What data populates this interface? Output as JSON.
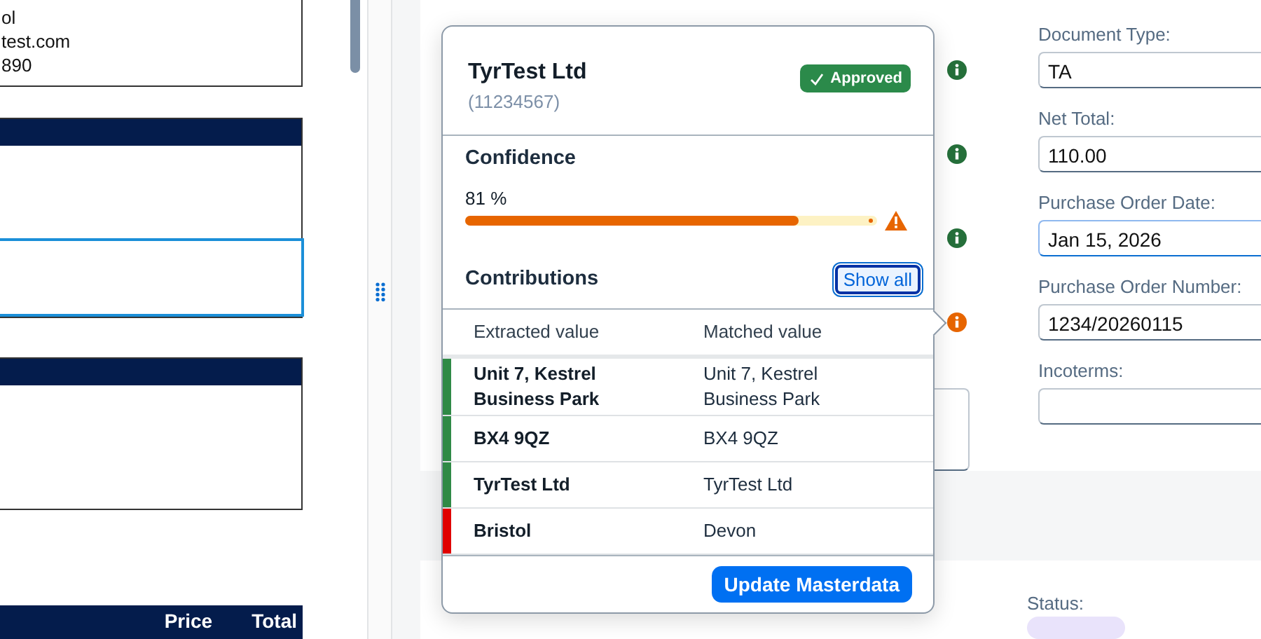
{
  "document": {
    "address_lines": [
      "ol",
      "test.com",
      "890"
    ],
    "sections": [
      {
        "cells": [
          {
            "selected": false
          },
          {
            "selected": true
          }
        ]
      },
      {
        "cells": [
          {
            "selected": false
          }
        ]
      }
    ],
    "table_columns": [
      "Price",
      "Total"
    ]
  },
  "form": {
    "fields": [
      {
        "label": "Document Type:",
        "value": "TA",
        "color": "#256f3a",
        "focused": false
      },
      {
        "label": "Net Total:",
        "value": "110.00",
        "color": "#256f3a",
        "focused": false
      },
      {
        "label": "Purchase Order Date:",
        "value": "Jan 15, 2026",
        "color": "#256f3a",
        "focused": true
      },
      {
        "label": "Purchase Order Number:",
        "value": "1234/20260115",
        "color": "#e76500",
        "focused": false
      },
      {
        "label": "Incoterms:"
      }
    ],
    "status_label": "Status:"
  },
  "popover": {
    "title": "TyrTest Ltd",
    "subtitle": "(11234567)",
    "badge": "Approved",
    "confidence_title": "Confidence",
    "confidence_reading": "81 %",
    "level": 0.81,
    "contributions_title": "Contributions",
    "show_all": "Show all",
    "columns": [
      "Extracted value",
      "Matched value"
    ],
    "rows": [
      {
        "extracted": "Unit 7, Kestrel Business Park",
        "matched": "Unit 7, Kestrel Business Park",
        "color": "#2f8a46"
      },
      {
        "extracted": "BX4 9QZ",
        "matched": "BX4 9QZ",
        "color": "#2f8a46"
      },
      {
        "extracted": "TyrTest Ltd",
        "matched": "TyrTest Ltd",
        "color": "#2f8a46"
      },
      {
        "extracted": "Bristol",
        "matched": "Devon",
        "color": "#e00000"
      }
    ],
    "action": "Update Masterdata"
  }
}
